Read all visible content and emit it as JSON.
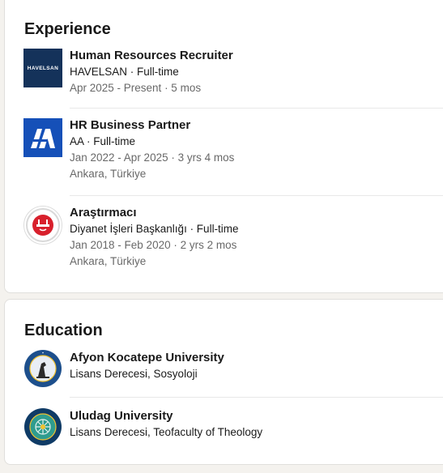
{
  "experience": {
    "title": "Experience",
    "items": [
      {
        "logo_text": "HAVELSAN",
        "logo_icon": "havelsan-logo",
        "role": "Human Resources Recruiter",
        "company": "HAVELSAN · Full-time",
        "dates": "Apr 2025 - Present · 5 mos",
        "location": ""
      },
      {
        "logo_icon": "anadolu-agency-logo",
        "role": "HR Business Partner",
        "company": "AA · Full-time",
        "dates": "Jan 2022 - Apr 2025 · 3 yrs 4 mos",
        "location": "Ankara, Türkiye"
      },
      {
        "logo_icon": "diyanet-logo",
        "role": "Araştırmacı",
        "company": "Diyanet İşleri Başkanlığı · Full-time",
        "dates": "Jan 2018 - Feb 2020 · 2 yrs 2 mos",
        "location": "Ankara, Türkiye"
      }
    ]
  },
  "education": {
    "title": "Education",
    "items": [
      {
        "logo_icon": "afyon-kocatepe-seal-logo",
        "school": "Afyon Kocatepe University",
        "degree": "Lisans Derecesi, Sosyoloji"
      },
      {
        "logo_icon": "uludag-seal-logo",
        "school": "Uludag University",
        "degree": "Lisans Derecesi, Teofaculty of Theology"
      }
    ]
  },
  "colors": {
    "havelsan_bg": "#14325a",
    "aa_bg": "#1550b8",
    "diyanet_red": "#d8202c",
    "seal_blue": "#1d4f8c"
  }
}
